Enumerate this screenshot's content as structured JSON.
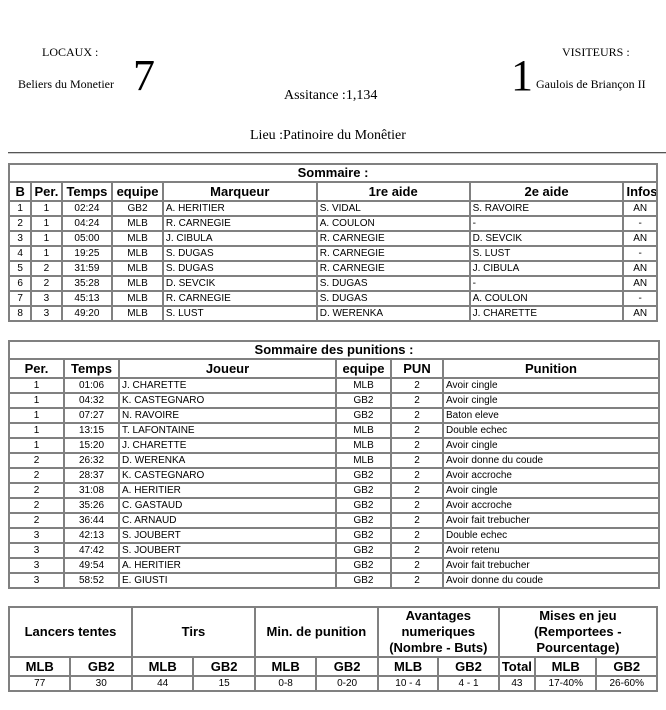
{
  "header": {
    "home_label": "LOCAUX :",
    "home_team": "Beliers du Monetier",
    "home_score": "7",
    "away_label": "VISITEURS :",
    "away_team": "Gaulois de Briançon II",
    "away_score": "1",
    "attendance": "Assitance :1,134",
    "venue": "Lieu :Patinoire du Monêtier"
  },
  "goals": {
    "title": "Sommaire :",
    "columns": [
      "B",
      "Per.",
      "Temps",
      "equipe",
      "Marqueur",
      "1re aide",
      "2e aide",
      "Infos"
    ],
    "rows": [
      [
        "1",
        "1",
        "02:24",
        "GB2",
        "A. HERITIER",
        "S. VIDAL",
        "S. RAVOIRE",
        "AN"
      ],
      [
        "2",
        "1",
        "04:24",
        "MLB",
        "R. CARNEGIE",
        "A. COULON",
        "-",
        "-"
      ],
      [
        "3",
        "1",
        "05:00",
        "MLB",
        "J. CIBULA",
        "R. CARNEGIE",
        "D. SEVCIK",
        "AN"
      ],
      [
        "4",
        "1",
        "19:25",
        "MLB",
        "S. DUGAS",
        "R. CARNEGIE",
        "S. LUST",
        "-"
      ],
      [
        "5",
        "2",
        "31:59",
        "MLB",
        "S. DUGAS",
        "R. CARNEGIE",
        "J. CIBULA",
        "AN"
      ],
      [
        "6",
        "2",
        "35:28",
        "MLB",
        "D. SEVCIK",
        "S. DUGAS",
        "-",
        "AN"
      ],
      [
        "7",
        "3",
        "45:13",
        "MLB",
        "R. CARNEGIE",
        "S. DUGAS",
        "A. COULON",
        "-"
      ],
      [
        "8",
        "3",
        "49:20",
        "MLB",
        "S. LUST",
        "D. WERENKA",
        "J. CHARETTE",
        "AN"
      ]
    ]
  },
  "penalties": {
    "title": "Sommaire des punitions :",
    "columns": [
      "Per.",
      "Temps",
      "Joueur",
      "equipe",
      "PUN",
      "Punition"
    ],
    "rows": [
      [
        "1",
        "01:06",
        "J. CHARETTE",
        "MLB",
        "2",
        "Avoir cingle"
      ],
      [
        "1",
        "04:32",
        "K. CASTEGNARO",
        "GB2",
        "2",
        "Avoir cingle"
      ],
      [
        "1",
        "07:27",
        "N. RAVOIRE",
        "GB2",
        "2",
        "Baton eleve"
      ],
      [
        "1",
        "13:15",
        "T. LAFONTAINE",
        "MLB",
        "2",
        "Double echec"
      ],
      [
        "1",
        "15:20",
        "J. CHARETTE",
        "MLB",
        "2",
        "Avoir cingle"
      ],
      [
        "2",
        "26:32",
        "D. WERENKA",
        "MLB",
        "2",
        "Avoir donne du coude"
      ],
      [
        "2",
        "28:37",
        "K. CASTEGNARO",
        "GB2",
        "2",
        "Avoir accroche"
      ],
      [
        "2",
        "31:08",
        "A. HERITIER",
        "GB2",
        "2",
        "Avoir cingle"
      ],
      [
        "2",
        "35:26",
        "C. GASTAUD",
        "GB2",
        "2",
        "Avoir accroche"
      ],
      [
        "2",
        "36:44",
        "C. ARNAUD",
        "GB2",
        "2",
        "Avoir fait trebucher"
      ],
      [
        "3",
        "42:13",
        "S. JOUBERT",
        "GB2",
        "2",
        "Double echec"
      ],
      [
        "3",
        "47:42",
        "S. JOUBERT",
        "GB2",
        "2",
        "Avoir retenu"
      ],
      [
        "3",
        "49:54",
        "A. HERITIER",
        "GB2",
        "2",
        "Avoir fait trebucher"
      ],
      [
        "3",
        "58:52",
        "E. GIUSTI",
        "GB2",
        "2",
        "Avoir donne du coude"
      ]
    ]
  },
  "stats": {
    "groups": [
      "Lancers tentes",
      "Tirs",
      "Min. de punition",
      "Avantages numeriques (Nombre - Buts)",
      "Mises en jeu (Remportees - Pourcentage)"
    ],
    "subheaders": [
      "MLB",
      "GB2",
      "MLB",
      "GB2",
      "MLB",
      "GB2",
      "MLB",
      "GB2",
      "Total",
      "MLB",
      "GB2"
    ],
    "values": [
      "77",
      "30",
      "44",
      "15",
      "0-8",
      "0-20",
      "10 - 4",
      "4 - 1",
      "43",
      "17-40%",
      "26-60%"
    ]
  }
}
